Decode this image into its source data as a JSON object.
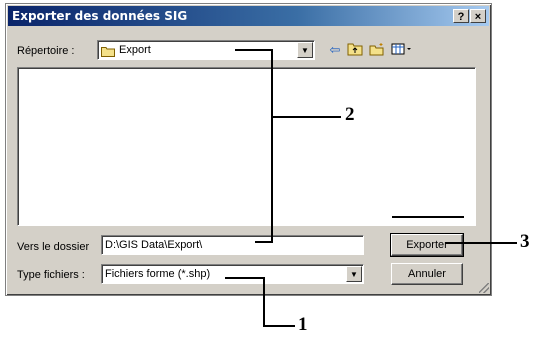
{
  "dialog": {
    "title": "Exporter des données SIG",
    "help_label": "?",
    "close_label": "×"
  },
  "directory": {
    "label": "Répertoire :",
    "value": "Export"
  },
  "toolbar": {
    "back_icon": "back-arrow-icon",
    "up_icon": "up-folder-icon",
    "new_folder_icon": "new-folder-icon",
    "view_icon": "view-menu-icon"
  },
  "folder_field": {
    "label": "Vers le dossier",
    "value": "D:\\GIS Data\\Export\\"
  },
  "filetype": {
    "label": "Type fichiers :",
    "value": "Fichiers forme (*.shp)"
  },
  "buttons": {
    "export_label": "Exporter",
    "cancel_label": "Annuler"
  },
  "callouts": {
    "one": "1",
    "two": "2",
    "three": "3"
  }
}
